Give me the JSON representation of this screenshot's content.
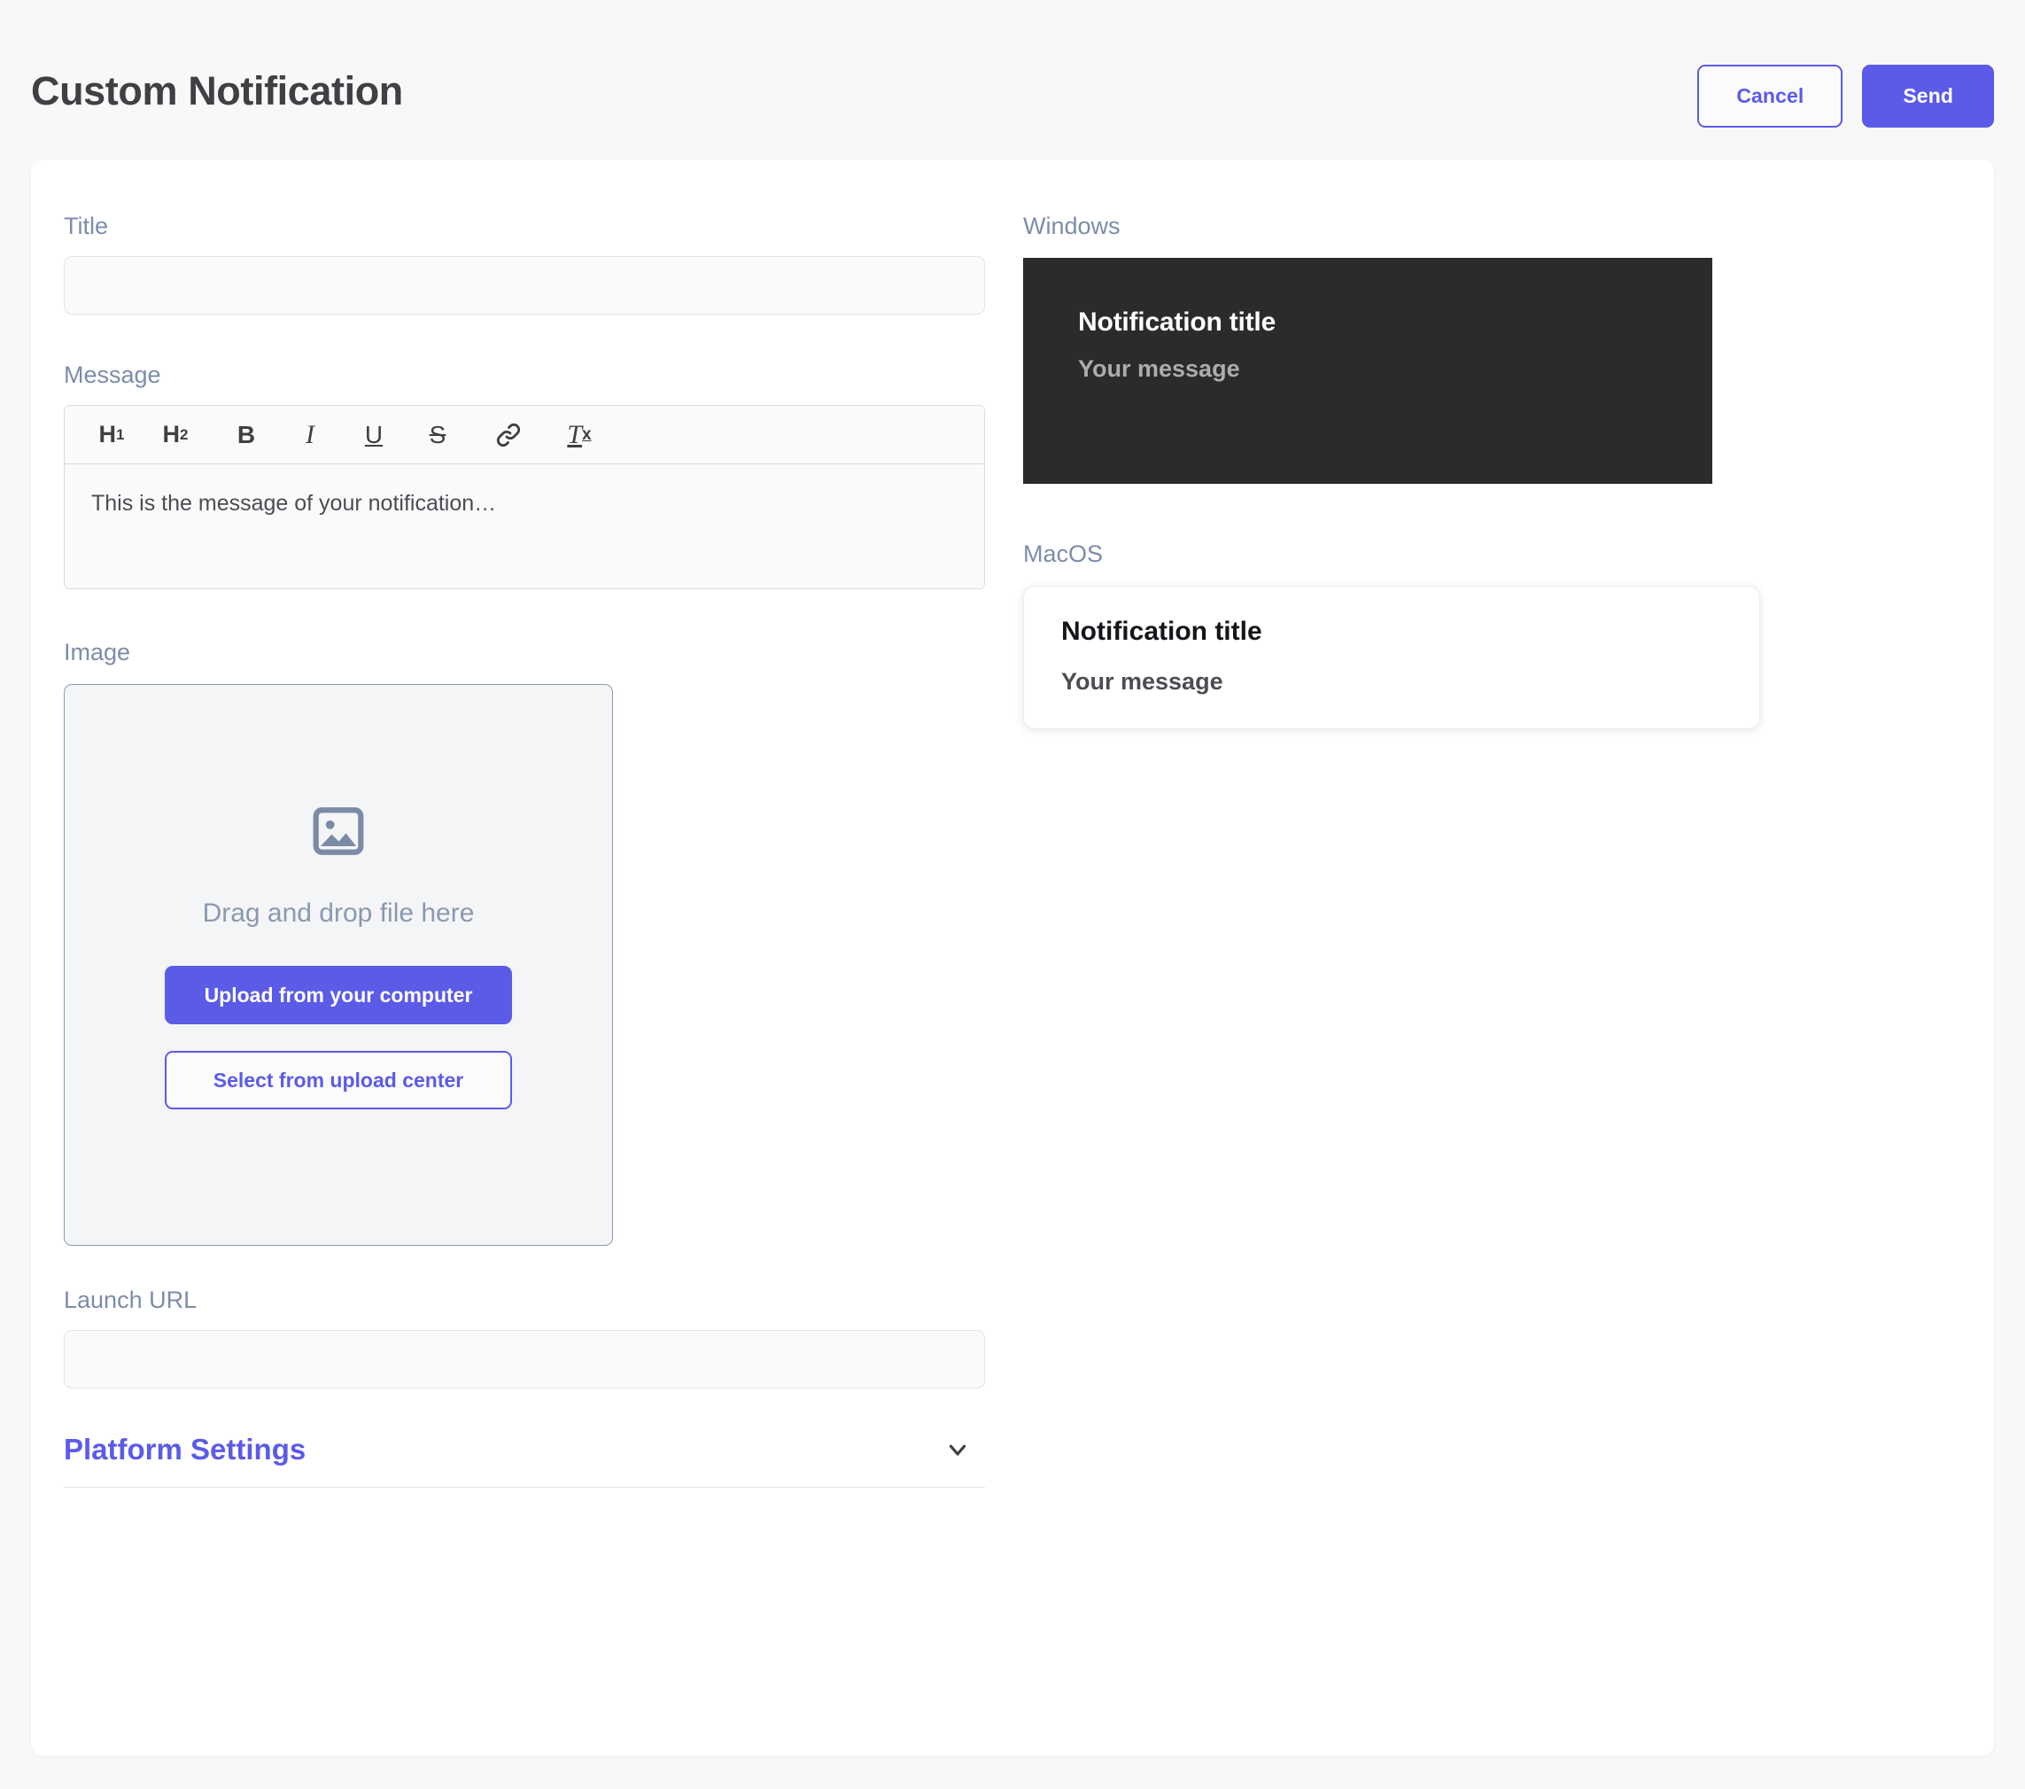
{
  "header": {
    "title": "Custom Notification",
    "cancel_label": "Cancel",
    "send_label": "Send"
  },
  "form": {
    "title": {
      "label": "Title",
      "value": "",
      "placeholder": ""
    },
    "message": {
      "label": "Message",
      "body_text": "This is the message of your notification…",
      "toolbar": [
        {
          "name": "heading-1-icon",
          "glyph": "H",
          "sub": "1"
        },
        {
          "name": "heading-2-icon",
          "glyph": "H",
          "sub": "2"
        },
        {
          "name": "bold-icon",
          "glyph": "B"
        },
        {
          "name": "italic-icon",
          "glyph": "I"
        },
        {
          "name": "underline-icon",
          "glyph": "U"
        },
        {
          "name": "strikethrough-icon",
          "glyph": "S"
        },
        {
          "name": "link-icon",
          "glyph": "link"
        },
        {
          "name": "clear-formatting-icon",
          "glyph": "T",
          "sub": "x"
        }
      ]
    },
    "image": {
      "label": "Image",
      "dropzone_icon": "image-placeholder-icon",
      "dropzone_text": "Drag and drop file here",
      "upload_button_label": "Upload from your computer",
      "select_button_label": "Select from upload center"
    },
    "launch_url": {
      "label": "Launch URL",
      "value": "",
      "placeholder": ""
    },
    "platform_settings": {
      "label": "Platform Settings",
      "chevron_icon": "chevron-down-icon",
      "expanded": false
    }
  },
  "previews": {
    "windows": {
      "label": "Windows",
      "title": "Notification title",
      "message": "Your message"
    },
    "macos": {
      "label": "MacOS",
      "title": "Notification title",
      "message": "Your message"
    }
  },
  "colors": {
    "accent": "#5b5be8",
    "page_background": "#f8f8f9",
    "card_background": "#ffffff",
    "label_text": "#7d8cab",
    "windows_preview_background": "#2b2b2c"
  }
}
